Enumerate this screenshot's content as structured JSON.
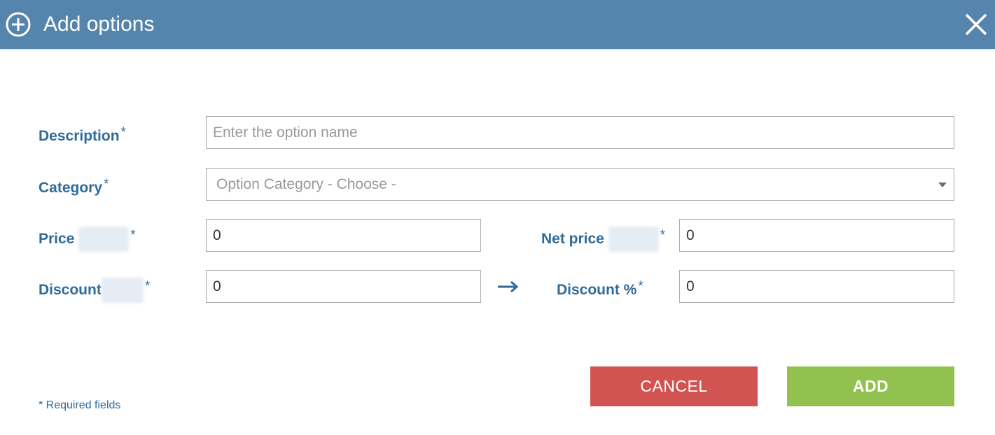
{
  "dialog": {
    "title": "Add options",
    "icons": {
      "title": "add-circle-icon",
      "close": "close-icon",
      "arrow": "arrow-right-icon"
    }
  },
  "form": {
    "required_marker": "*",
    "description": {
      "label": "Description",
      "placeholder": "Enter the option name",
      "value": ""
    },
    "category": {
      "label": "Category",
      "selected": "Option Category - Choose -"
    },
    "price": {
      "label": "Price",
      "value": "0"
    },
    "net_price": {
      "label": "Net price",
      "value": "0"
    },
    "discount": {
      "label": "Discount",
      "value": "0"
    },
    "discount_percent": {
      "label": "Discount %",
      "value": "0"
    }
  },
  "buttons": {
    "cancel": "CANCEL",
    "add": "ADD"
  },
  "footnote": "* Required fields",
  "colors": {
    "header": "#5585ad",
    "label": "#2f6b9a",
    "cancel": "#d25452",
    "add": "#93c150"
  }
}
